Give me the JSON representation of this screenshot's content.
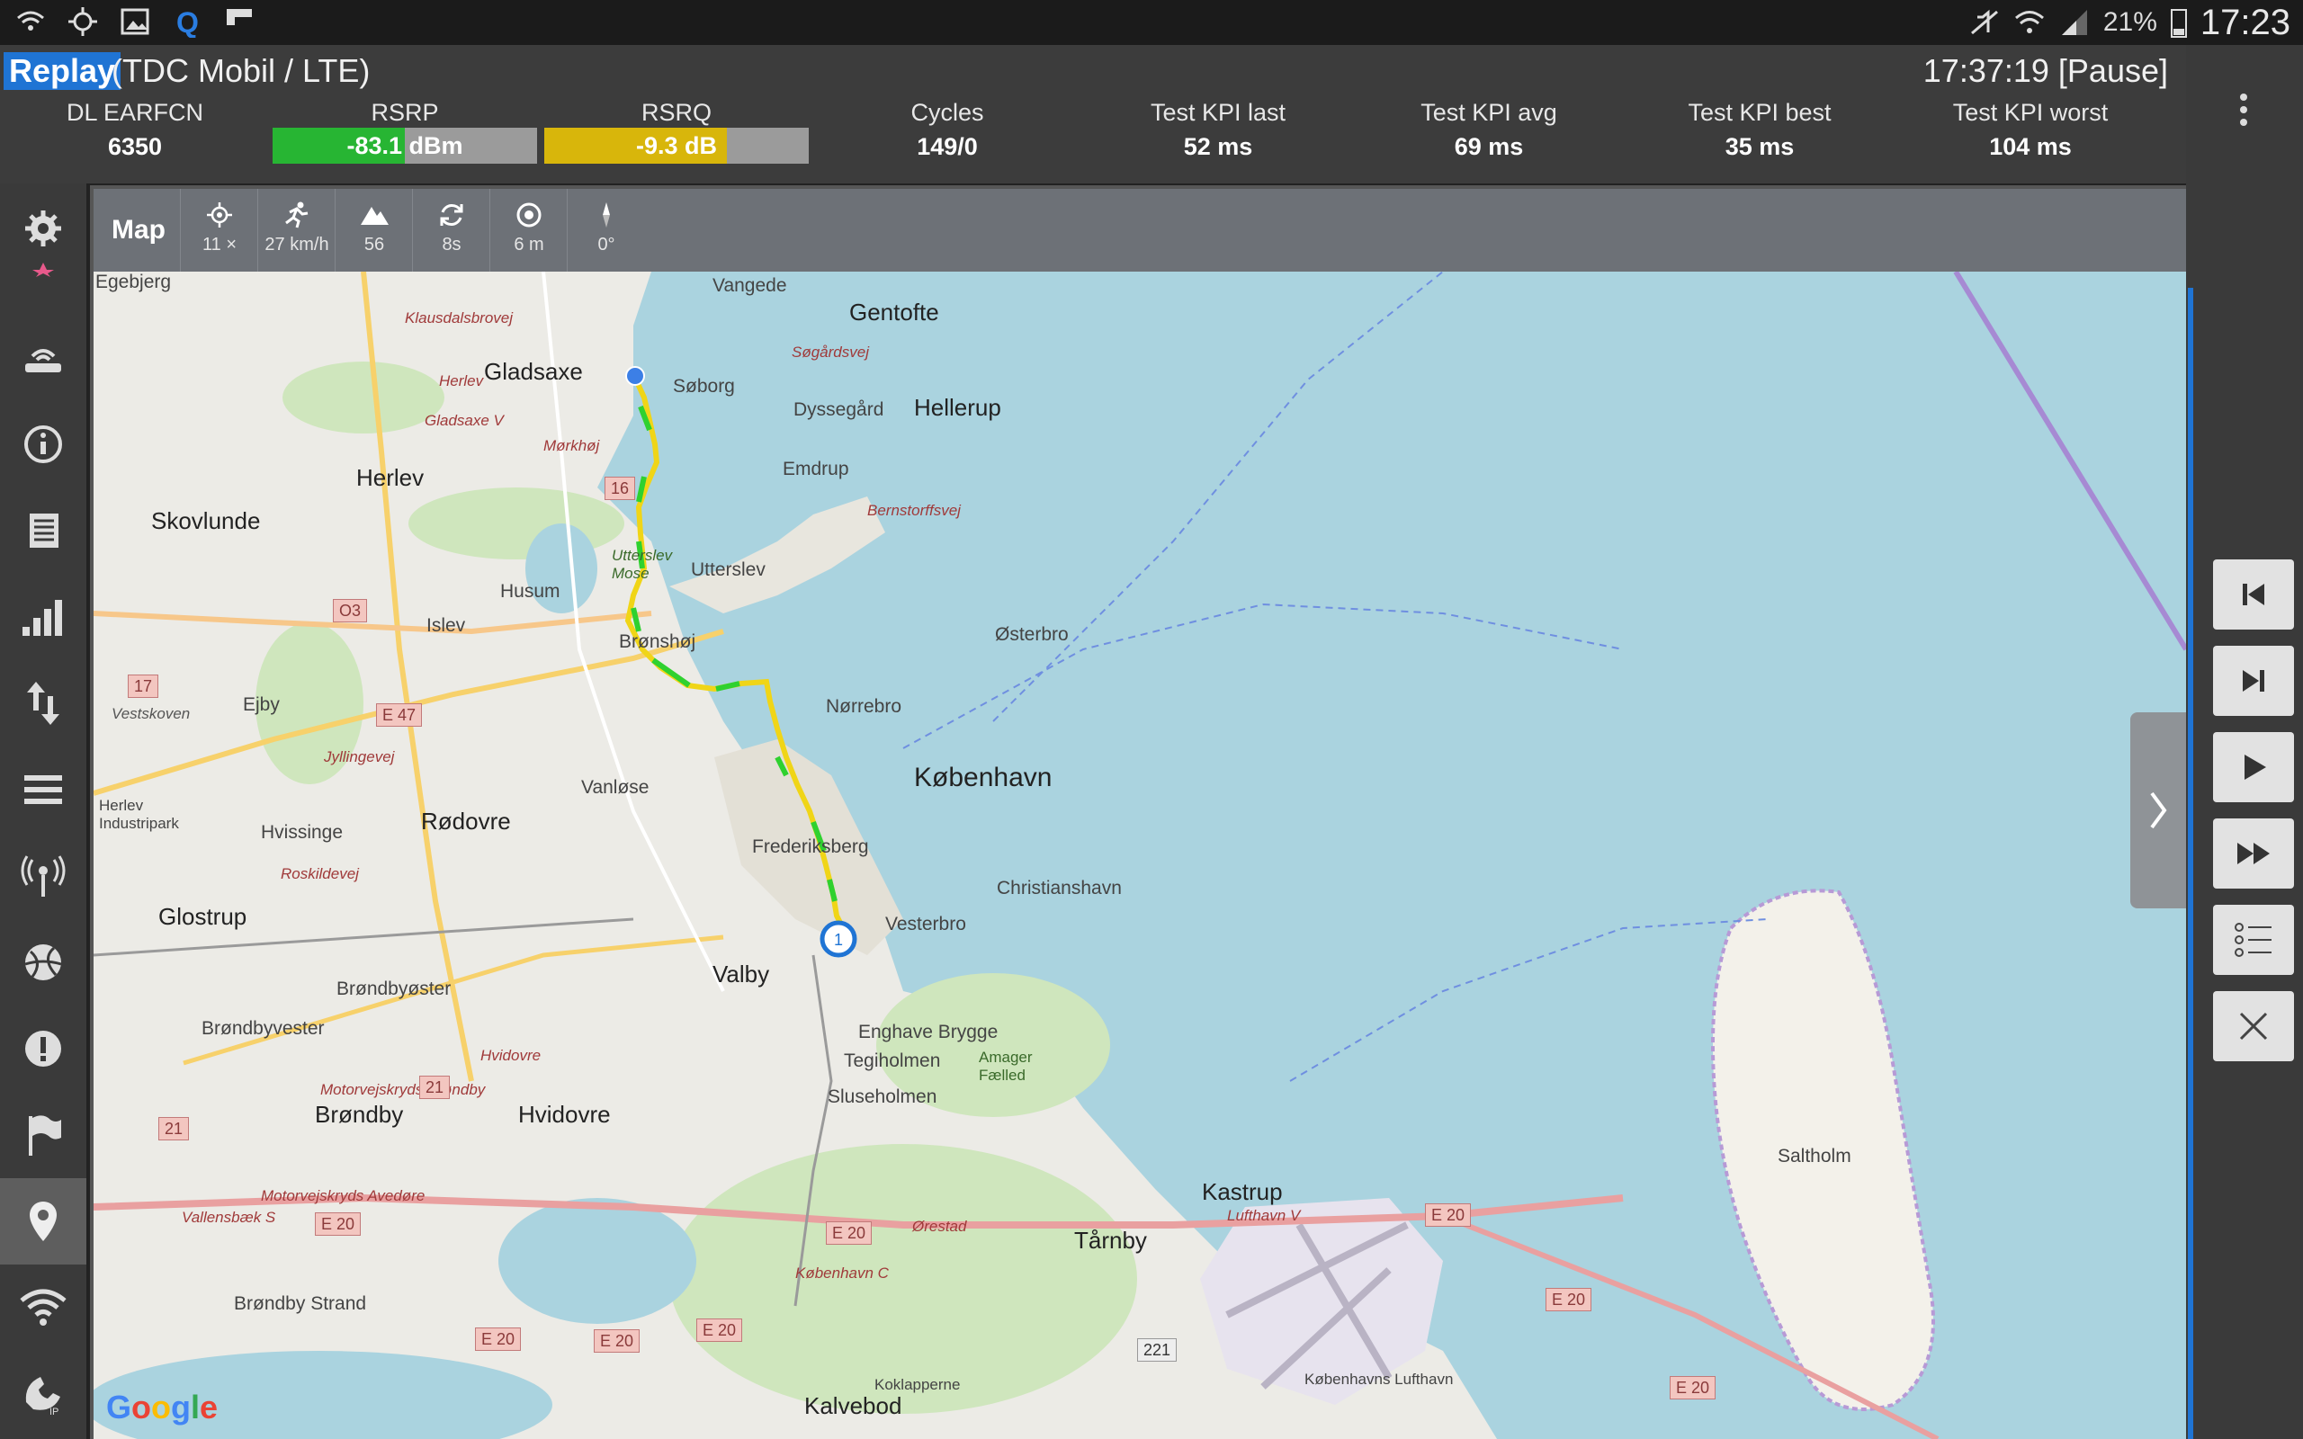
{
  "status_bar": {
    "battery": "21%",
    "clock": "17:23",
    "icons": [
      "wifi-call-icon",
      "gps-icon",
      "gallery-icon",
      "q-icon",
      "flipboard-icon",
      "mute-icon",
      "wifi-icon",
      "signal-icon",
      "battery-icon"
    ]
  },
  "header": {
    "mode": "Replay",
    "connection": "(TDC Mobil / LTE)",
    "time_status": "17:37:19 [Pause]",
    "kpis": [
      {
        "label": "DL EARFCN",
        "value": "6350"
      },
      {
        "label": "RSRP",
        "value": "-83.1 dBm",
        "bar_fill": 0.5,
        "color": "#27b533"
      },
      {
        "label": "RSRQ",
        "value": "-9.3 dB",
        "bar_fill": 0.69,
        "color": "#d8b60b"
      },
      {
        "label": "Cycles",
        "value": "149/0"
      },
      {
        "label": "Test KPI last",
        "value": "52 ms"
      },
      {
        "label": "Test KPI avg",
        "value": "69 ms"
      },
      {
        "label": "Test KPI best",
        "value": "35 ms"
      },
      {
        "label": "Test KPI worst",
        "value": "104 ms"
      }
    ]
  },
  "map_toolbar": {
    "title": "Map",
    "tools": [
      {
        "icon": "gps-target-icon",
        "value": "11 ×"
      },
      {
        "icon": "runner-icon",
        "value": "27 km/h"
      },
      {
        "icon": "mountain-icon",
        "value": "56"
      },
      {
        "icon": "refresh-icon",
        "value": "8s"
      },
      {
        "icon": "accuracy-icon",
        "value": "6 m"
      },
      {
        "icon": "compass-needle-icon",
        "value": "0°"
      }
    ]
  },
  "sidebar": [
    "settings-icon",
    "router-icon",
    "info-icon",
    "document-icon",
    "signal-bars-icon",
    "transfer-icon",
    "list-icon",
    "antenna-icon",
    "sports-ball-icon",
    "alert-icon",
    "flag-icon",
    "location-pin-icon",
    "wifi-icon",
    "phone-ip-icon"
  ],
  "controls": [
    "skip-previous-icon",
    "skip-next-icon",
    "play-icon",
    "fast-forward-icon",
    "list-checklist-icon",
    "close-icon"
  ],
  "map": {
    "attribution": "Google",
    "marker_label": "1",
    "places": [
      {
        "name": "Egebjerg",
        "cls": "place"
      },
      {
        "name": "Vangede",
        "cls": "place"
      },
      {
        "name": "Gentofte",
        "cls": "place big"
      },
      {
        "name": "Gladsaxe",
        "cls": "place big"
      },
      {
        "name": "Søborg",
        "cls": "place"
      },
      {
        "name": "Dyssegård",
        "cls": "place"
      },
      {
        "name": "Hellerup",
        "cls": "place big"
      },
      {
        "name": "Emdrup",
        "cls": "place"
      },
      {
        "name": "Herlev",
        "cls": "place big"
      },
      {
        "name": "Skovlunde",
        "cls": "place big"
      },
      {
        "name": "Husum",
        "cls": "place"
      },
      {
        "name": "Utterslev",
        "cls": "place"
      },
      {
        "name": "Islev",
        "cls": "place"
      },
      {
        "name": "Brønshøj",
        "cls": "place"
      },
      {
        "name": "Østerbro",
        "cls": "place"
      },
      {
        "name": "Ejby",
        "cls": "place"
      },
      {
        "name": "Nørrebro",
        "cls": "place"
      },
      {
        "name": "København",
        "cls": "place huge"
      },
      {
        "name": "Vanløse",
        "cls": "place"
      },
      {
        "name": "Rødovre",
        "cls": "place big"
      },
      {
        "name": "Hvissinge",
        "cls": "place"
      },
      {
        "name": "Frederiksberg",
        "cls": "place"
      },
      {
        "name": "Christianshavn",
        "cls": "place"
      },
      {
        "name": "Glostrup",
        "cls": "place big"
      },
      {
        "name": "Vesterbro",
        "cls": "place"
      },
      {
        "name": "Valby",
        "cls": "place big"
      },
      {
        "name": "Brøndbyøster",
        "cls": "place"
      },
      {
        "name": "Brøndbyvester",
        "cls": "place"
      },
      {
        "name": "Enghave Brygge",
        "cls": "place"
      },
      {
        "name": "Tegiholmen",
        "cls": "place"
      },
      {
        "name": "Sluseholmen",
        "cls": "place"
      },
      {
        "name": "Brøndby",
        "cls": "place big"
      },
      {
        "name": "Hvidovre",
        "cls": "place big"
      },
      {
        "name": "Kastrup",
        "cls": "place big"
      },
      {
        "name": "Tårnby",
        "cls": "place big"
      },
      {
        "name": "Saltholm",
        "cls": "place"
      },
      {
        "name": "Brøndby Strand",
        "cls": "place"
      },
      {
        "name": "Kalvebod",
        "cls": "place big"
      },
      {
        "name": "Københavns Lufthavn",
        "cls": "place"
      },
      {
        "name": "Herlev Industripark",
        "cls": "place"
      },
      {
        "name": "Amager Fælled",
        "cls": "place"
      },
      {
        "name": "Koklapperne",
        "cls": "place"
      }
    ],
    "roads": [
      "Klausdalsbrovej",
      "Søgårdsvej",
      "Herlev",
      "Gladsaxe V",
      "Mørkhøj",
      "Bernstorffsvej",
      "Utterslev Mose",
      "Vestskoven",
      "Jyllingevej",
      "Roskildevej",
      "Motorvejskryds Brøndby",
      "Hvidovre",
      "Motorvejskryds Avedøre",
      "Vallensbæk S",
      "Ørestad",
      "København C",
      "Lufthavn V"
    ],
    "shields": [
      "16",
      "O3",
      "17",
      "E 47",
      "21",
      "21",
      "E 20",
      "E 20",
      "E 20",
      "E 20",
      "E 20",
      "E 20",
      "E 20",
      "E 20",
      "221"
    ]
  }
}
